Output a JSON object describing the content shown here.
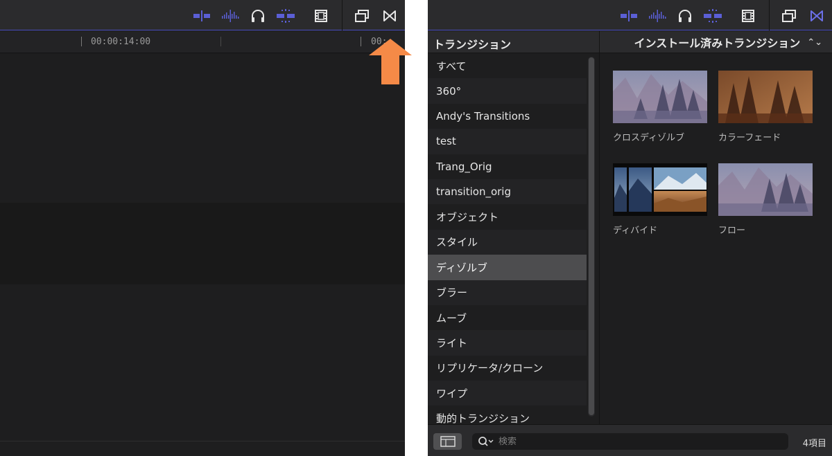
{
  "colors": {
    "accent": "#5b5fd6",
    "arrow": "#f58a47",
    "panel_bg": "#1e1e1f",
    "toolbar_bg": "#2b2b2d",
    "selected_row": "#4d4d4f"
  },
  "left": {
    "toolbar": {
      "icons": [
        "skimming-icon",
        "audio-skimming-icon",
        "headphones-icon",
        "snapping-icon",
        "filmstrip-icon",
        "effects-browser-icon",
        "transitions-browser-icon"
      ]
    },
    "timecodes": [
      "00:00:14:00",
      "00:"
    ]
  },
  "right": {
    "toolbar": {
      "icons": [
        "skimming-icon",
        "audio-skimming-icon",
        "headphones-icon",
        "snapping-icon",
        "filmstrip-icon",
        "effects-browser-icon",
        "transitions-browser-icon"
      ]
    },
    "browser": {
      "title": "トランジション",
      "selector_label": "インストール済みトランジション",
      "categories": [
        "すべて",
        "360°",
        "Andy's Transitions",
        "test",
        "Trang_Orig",
        "transition_orig",
        "オブジェクト",
        "スタイル",
        "ディゾルブ",
        "ブラー",
        "ムーブ",
        "ライト",
        "リプリケータ/クローン",
        "ワイプ",
        "動的トランジション"
      ],
      "selected_category": "ディゾルブ",
      "items": [
        {
          "name": "クロスディゾルブ",
          "thumbnail": "forest-crossfade"
        },
        {
          "name": "カラーフェード",
          "thumbnail": "forest-sepia"
        },
        {
          "name": "ディバイド",
          "thumbnail": "mountain-split"
        },
        {
          "name": "フロー",
          "thumbnail": "forest-crossfade"
        }
      ]
    },
    "footer": {
      "search_placeholder": "検索",
      "item_count": "4項目"
    }
  }
}
